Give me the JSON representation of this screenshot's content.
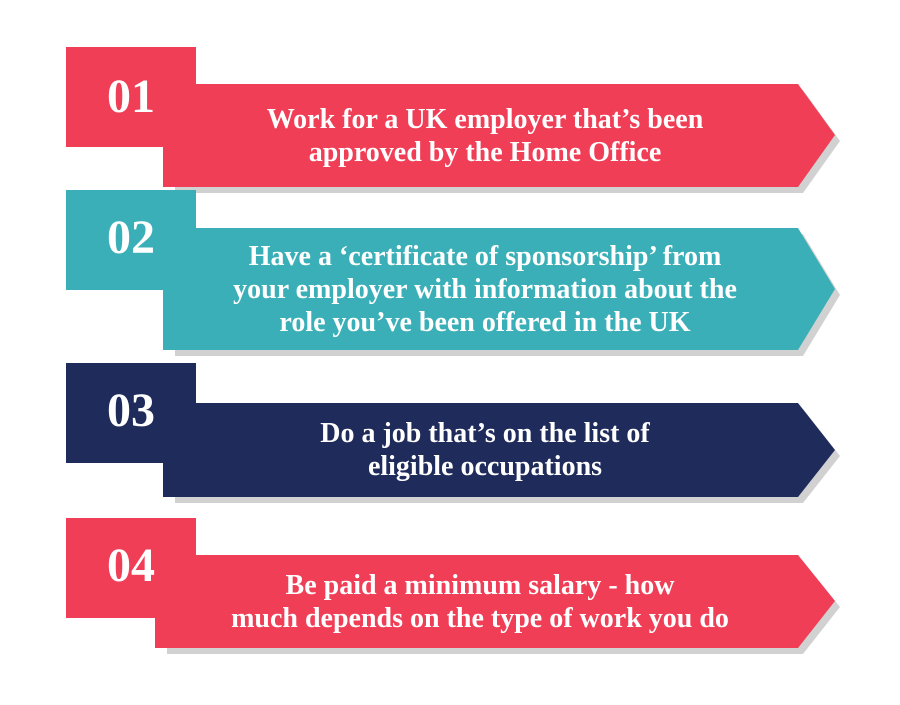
{
  "colors": {
    "red": "#f03e56",
    "red_dark": "#b0233a",
    "teal": "#3aafb7",
    "teal_dark": "#1f7c83",
    "navy": "#1f2b5b",
    "navy_dark": "#101836"
  },
  "steps": [
    {
      "number": "01",
      "lines": [
        "Work for a UK employer that’s been",
        "approved by the Home Office"
      ],
      "color": "red"
    },
    {
      "number": "02",
      "lines": [
        "Have a ‘certificate of sponsorship’ from",
        "your employer with information about the",
        "role you’ve been offered in the UK"
      ],
      "color": "teal"
    },
    {
      "number": "03",
      "lines": [
        "Do a job that’s on the list of",
        "eligible occupations"
      ],
      "color": "navy"
    },
    {
      "number": "04",
      "lines": [
        "Be paid a minimum salary - how",
        "much depends on the type of work you do"
      ],
      "color": "red"
    }
  ]
}
